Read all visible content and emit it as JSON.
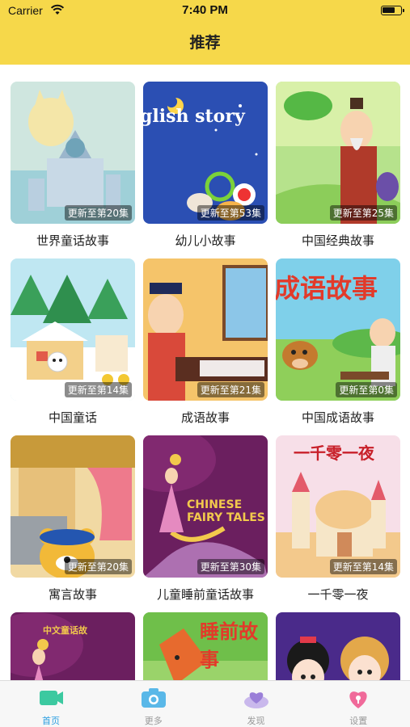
{
  "status_bar": {
    "carrier": "Carrier",
    "time": "7:40 PM",
    "battery_level": 0.75
  },
  "nav": {
    "title": "推荐"
  },
  "colors": {
    "header_bg": "#f6d84a",
    "tab_active": "#2a9ee0",
    "tab_inactive": "#999999"
  },
  "items": [
    {
      "title": "世界童话故事",
      "badge": "更新至第20集",
      "art": "castle-cat",
      "thumb_text": ""
    },
    {
      "title": "幼儿小故事",
      "badge": "更新至第53集",
      "art": "english-story",
      "thumb_text": "glish story"
    },
    {
      "title": "中国经典故事",
      "badge": "更新至第25集",
      "art": "old-man",
      "thumb_text": ""
    },
    {
      "title": "中国童话",
      "badge": "更新至第14集",
      "art": "snow-house",
      "thumb_text": ""
    },
    {
      "title": "成语故事",
      "badge": "更新至第21集",
      "art": "scholar",
      "thumb_text": ""
    },
    {
      "title": "中国成语故事",
      "badge": "更新至第0集",
      "art": "idiom-cow",
      "thumb_text": "成语故事"
    },
    {
      "title": "寓言故事",
      "badge": "更新至第20集",
      "art": "bear-house",
      "thumb_text": ""
    },
    {
      "title": "儿童睡前童话故事",
      "badge": "更新至第30集",
      "art": "fairy-purple",
      "thumb_text": "CHINESE FAIRY TALES"
    },
    {
      "title": "一千零一夜",
      "badge": "更新至第14集",
      "art": "arabian-palace",
      "thumb_text": "一千零一夜"
    },
    {
      "title": "",
      "badge": "",
      "art": "fairy-purple-2",
      "thumb_text": "中文童话故"
    },
    {
      "title": "",
      "badge": "",
      "art": "fox-story",
      "thumb_text": "睡前故事"
    },
    {
      "title": "",
      "badge": "",
      "art": "princess",
      "thumb_text": ""
    }
  ],
  "tabs": [
    {
      "label": "首页",
      "icon": "video-camera-icon",
      "active": true
    },
    {
      "label": "更多",
      "icon": "camera-icon",
      "active": false
    },
    {
      "label": "发现",
      "icon": "heart-cloud-icon",
      "active": false
    },
    {
      "label": "设置",
      "icon": "heart-lock-icon",
      "active": false
    }
  ]
}
